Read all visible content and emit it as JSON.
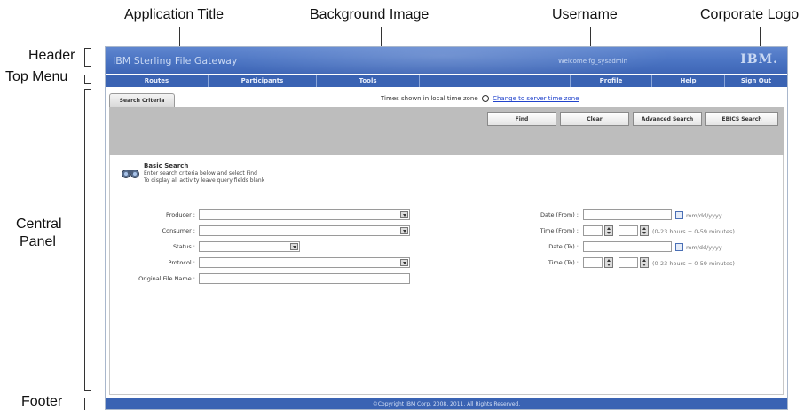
{
  "annotations": {
    "application_title": "Application Title",
    "background_image": "Background Image",
    "username": "Username",
    "corporate_logo": "Corporate Logo",
    "header": "Header",
    "top_menu": "Top Menu",
    "central_panel_line1": "Central",
    "central_panel_line2": "Panel",
    "footer": "Footer"
  },
  "header": {
    "app_title": "IBM Sterling File Gateway",
    "welcome": "Welcome fg_sysadmin",
    "logo_text": "IBM."
  },
  "menu": [
    "Routes",
    "Participants",
    "Tools",
    "",
    "Profile",
    "Help",
    "Sign Out"
  ],
  "tab": {
    "label": "Search Criteria"
  },
  "timezone": {
    "note": "Times shown in local time zone",
    "link": "Change to server time zone"
  },
  "buttons": {
    "find": "Find",
    "clear": "Clear",
    "advanced": "Advanced Search",
    "ebics": "EBICS Search"
  },
  "basic_search": {
    "title": "Basic Search",
    "line1": "Enter search criteria below and select Find",
    "line2": "To display all activity leave query fields blank"
  },
  "fields": {
    "producer": "Producer :",
    "consumer": "Consumer :",
    "status": "Status :",
    "protocol": "Protocol :",
    "original_file_name": "Original File Name :",
    "date_from": "Date (From) :",
    "time_from": "Time (From) :",
    "date_to": "Date (To) :",
    "time_to": "Time (To) :"
  },
  "hints": {
    "date_format": "mm/dd/yyyy",
    "time_format": "(0-23 hours + 0-59 minutes)"
  },
  "footer": {
    "copyright": "©Copyright IBM Corp. 2008, 2011. All Rights Reserved."
  },
  "colors": {
    "header_blue": "#4a73c2",
    "menu_blue": "#3a63b3",
    "toolbar_gray": "#bdbdbd"
  }
}
